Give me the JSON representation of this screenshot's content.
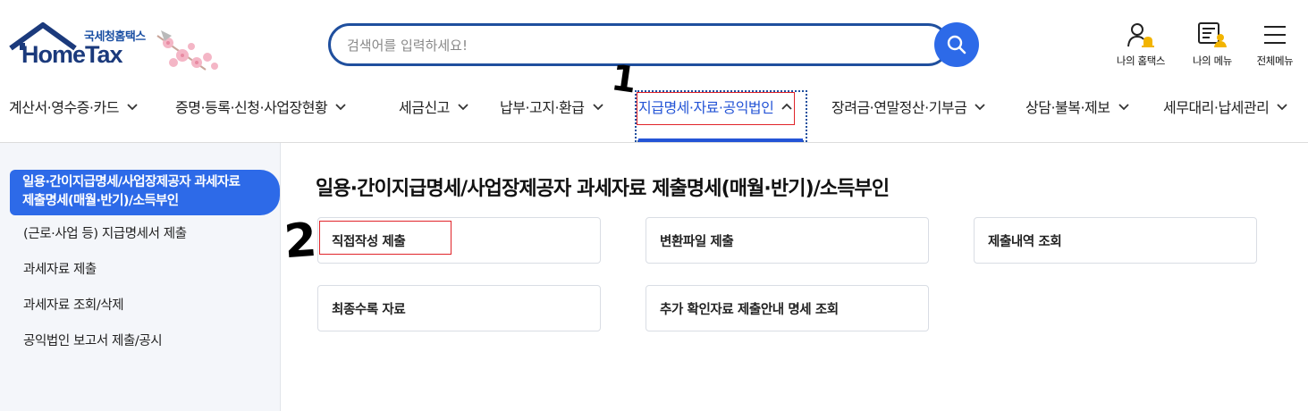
{
  "logo": {
    "sub": "국세청홈택스",
    "main": "HomeTax"
  },
  "search": {
    "placeholder": "검색어를 입력하세요!",
    "value": ""
  },
  "utility": [
    {
      "label": "나의 홈택스",
      "icon": "person-bell-icon"
    },
    {
      "label": "나의 메뉴",
      "icon": "list-person-icon"
    },
    {
      "label": "전체메뉴",
      "icon": "hamburger-icon"
    }
  ],
  "gnb": [
    {
      "label": "계산서·영수증·카드"
    },
    {
      "label": "증명·등록·신청·사업장현황"
    },
    {
      "label": "세금신고"
    },
    {
      "label": "납부·고지·환급"
    },
    {
      "label": "지급명세·자료·공익법인",
      "active": true
    },
    {
      "label": "장려금·연말정산·기부금"
    },
    {
      "label": "상담·불복·제보"
    },
    {
      "label": "세무대리·납세관리"
    }
  ],
  "annotations": {
    "step1": "1",
    "step2": "2"
  },
  "sidebar": {
    "active": {
      "line1": "일용·간이지급명세/사업장제공자 과세자료",
      "line2": "제출명세(매월·반기)/소득부인"
    },
    "items": [
      {
        "label": "(근로·사업 등) 지급명세서 제출"
      },
      {
        "label": "과세자료 제출"
      },
      {
        "label": "과세자료 조회/삭제"
      },
      {
        "label": "공익법인 보고서 제출/공시"
      }
    ]
  },
  "main": {
    "title": "일용·간이지급명세/사업장제공자 과세자료 제출명세(매월·반기)/소득부인",
    "cards": [
      {
        "label": "직접작성 제출"
      },
      {
        "label": "변환파일 제출"
      },
      {
        "label": "제출내역 조회"
      },
      {
        "label": "최종수록 자료"
      },
      {
        "label": "추가 확인자료 제출안내 명세 조회"
      }
    ]
  },
  "colors": {
    "primary": "#2d6ae8",
    "navy": "#1f4f9e",
    "active_text": "#2454d6",
    "highlight_red": "#e0242a"
  }
}
